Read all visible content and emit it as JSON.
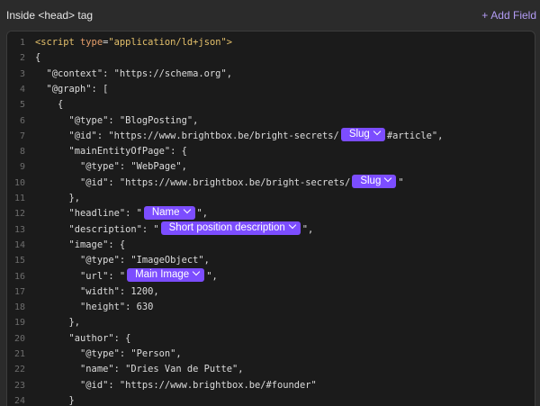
{
  "header": {
    "title": "Inside <head> tag",
    "add_field_label": "Add Field",
    "add_field_icon": "plus-icon",
    "accent_color": "#b39cf5"
  },
  "editor": {
    "pill_color": "#7c4dff",
    "lines": [
      {
        "n": "1",
        "parts": [
          {
            "t": "<script ",
            "c": "tag"
          },
          {
            "t": "type",
            "c": "attr"
          },
          {
            "t": "=",
            "c": "p"
          },
          {
            "t": "\"application/ld+json\"",
            "c": "tag"
          },
          {
            "t": ">",
            "c": "tag"
          }
        ]
      },
      {
        "n": "2",
        "parts": [
          {
            "t": "{",
            "c": "p"
          }
        ]
      },
      {
        "n": "3",
        "parts": [
          {
            "t": "  \"@context\": \"https://schema.org\",",
            "c": "p"
          }
        ]
      },
      {
        "n": "4",
        "parts": [
          {
            "t": "  \"@graph\": [",
            "c": "p"
          }
        ]
      },
      {
        "n": "5",
        "parts": [
          {
            "t": "    {",
            "c": "p"
          }
        ]
      },
      {
        "n": "6",
        "parts": [
          {
            "t": "      \"@type\": \"BlogPosting\",",
            "c": "p"
          }
        ]
      },
      {
        "n": "7",
        "parts": [
          {
            "t": "      \"@id\": \"https://www.brightbox.be/bright-secrets/",
            "c": "p"
          },
          {
            "pill": "Slug"
          },
          {
            "t": "#article\",",
            "c": "p"
          }
        ]
      },
      {
        "n": "8",
        "parts": [
          {
            "t": "      \"mainEntityOfPage\": {",
            "c": "p"
          }
        ]
      },
      {
        "n": "9",
        "parts": [
          {
            "t": "        \"@type\": \"WebPage\",",
            "c": "p"
          }
        ]
      },
      {
        "n": "10",
        "parts": [
          {
            "t": "        \"@id\": \"https://www.brightbox.be/bright-secrets/",
            "c": "p"
          },
          {
            "pill": "Slug"
          },
          {
            "t": "\"",
            "c": "p"
          }
        ]
      },
      {
        "n": "11",
        "parts": [
          {
            "t": "      },",
            "c": "p"
          }
        ]
      },
      {
        "n": "12",
        "parts": [
          {
            "t": "      \"headline\": \"",
            "c": "p"
          },
          {
            "pill": "Name"
          },
          {
            "t": "\",",
            "c": "p"
          }
        ]
      },
      {
        "n": "13",
        "parts": [
          {
            "t": "      \"description\": \"",
            "c": "p"
          },
          {
            "pill": "Short position description"
          },
          {
            "t": "\",",
            "c": "p"
          }
        ]
      },
      {
        "n": "14",
        "parts": [
          {
            "t": "      \"image\": {",
            "c": "p"
          }
        ]
      },
      {
        "n": "15",
        "parts": [
          {
            "t": "        \"@type\": \"ImageObject\",",
            "c": "p"
          }
        ]
      },
      {
        "n": "16",
        "parts": [
          {
            "t": "        \"url\": \"",
            "c": "p"
          },
          {
            "pill": "Main Image"
          },
          {
            "t": "\",",
            "c": "p"
          }
        ]
      },
      {
        "n": "17",
        "parts": [
          {
            "t": "        \"width\": 1200,",
            "c": "p"
          }
        ]
      },
      {
        "n": "18",
        "parts": [
          {
            "t": "        \"height\": 630",
            "c": "p"
          }
        ]
      },
      {
        "n": "19",
        "parts": [
          {
            "t": "      },",
            "c": "p"
          }
        ]
      },
      {
        "n": "20",
        "parts": [
          {
            "t": "      \"author\": {",
            "c": "p"
          }
        ]
      },
      {
        "n": "21",
        "parts": [
          {
            "t": "        \"@type\": \"Person\",",
            "c": "p"
          }
        ]
      },
      {
        "n": "22",
        "parts": [
          {
            "t": "        \"name\": \"Dries Van de Putte\",",
            "c": "p"
          }
        ]
      },
      {
        "n": "23",
        "parts": [
          {
            "t": "        \"@id\": \"https://www.brightbox.be/#founder\"",
            "c": "p"
          }
        ]
      },
      {
        "n": "24",
        "parts": [
          {
            "t": "      }",
            "c": "p"
          }
        ]
      }
    ]
  }
}
